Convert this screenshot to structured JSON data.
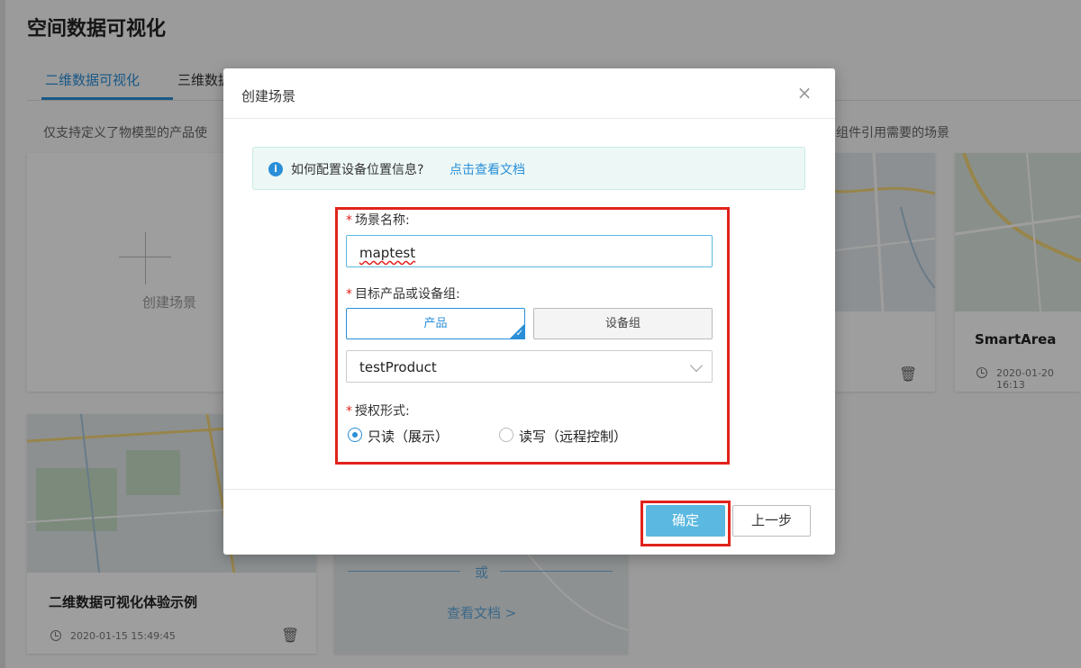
{
  "page": {
    "title": "空间数据可视化",
    "tabs": [
      {
        "label": "二维数据可视化",
        "active": true
      },
      {
        "label": "三维数据"
      }
    ],
    "hint_left": "仅支持定义了物模型的产品使",
    "hint_right": "组件引用需要的场景"
  },
  "cards": {
    "create_label": "创建场景",
    "smartarea": {
      "title": "SmartArea",
      "time": "2020-01-20 16:13"
    },
    "example": {
      "title": "二维数据可视化体验示例",
      "time": "2020-01-15 15:49:45"
    },
    "or_text": "或",
    "view_docs": "查看文档 >"
  },
  "modal": {
    "title": "创建场景",
    "close": "×",
    "info": {
      "icon": "i",
      "text": "如何配置设备位置信息?",
      "link": "点击查看文档"
    },
    "form": {
      "required_mark": "*",
      "scene_name_label": "场景名称:",
      "scene_name_value": "maptest",
      "target_label": "目标产品或设备组:",
      "segment_product": "产品",
      "segment_group": "设备组",
      "selected_product": "testProduct",
      "auth_label": "授权形式:",
      "auth_readonly": "只读（展示）",
      "auth_readwrite": "读写（远程控制）"
    },
    "buttons": {
      "confirm": "确定",
      "prev": "上一步"
    }
  },
  "colors": {
    "accent": "#2a8fd8",
    "confirm_bg": "#5bb8e0",
    "highlight_box": "#e0231c",
    "info_bg": "#edf8f6"
  }
}
